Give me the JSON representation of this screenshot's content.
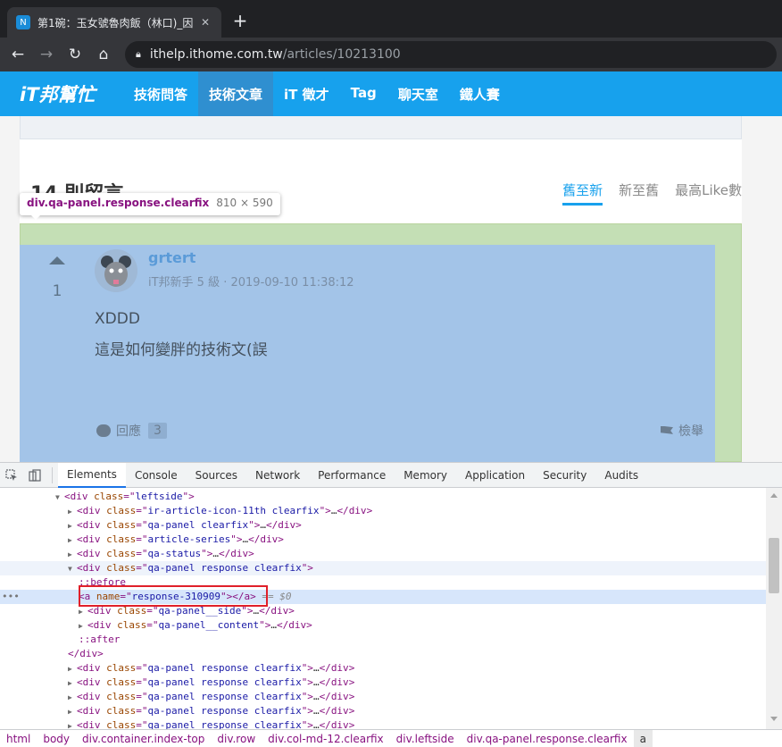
{
  "browser": {
    "tab_title": "第1碗：玉女號魯肉飯（林口)_因",
    "tab_favicon": "N",
    "url_host": "ithelp.ithome.com.tw",
    "url_path": "/articles/10213100"
  },
  "site": {
    "logo": "iT邦幫忙",
    "nav": [
      "技術問答",
      "技術文章",
      "iT 徵才",
      "Tag",
      "聊天室",
      "鐵人賽"
    ],
    "active_nav_index": 1,
    "accent_color": "#17a1ed"
  },
  "comments": {
    "heading": "14 則留言",
    "sort_options": [
      "舊至新",
      "新至舊",
      "最高Like數"
    ],
    "active_sort_index": 0
  },
  "inspector_tooltip": {
    "selector": "div.qa-panel.response.clearfix",
    "size": "810 × 590"
  },
  "comment": {
    "votes": "1",
    "author": "grtert",
    "meta": "iT邦新手 5 級 · 2019-09-10 11:38:12",
    "body_line1": "XDDD",
    "body_line2": "這是如何變胖的技術文(誤",
    "reply_label": "回應",
    "reply_count": "3",
    "report_label": "檢舉"
  },
  "devtools": {
    "tabs": [
      "Elements",
      "Console",
      "Sources",
      "Network",
      "Performance",
      "Memory",
      "Application",
      "Security",
      "Audits"
    ],
    "active_tab_index": 0,
    "breadcrumbs": [
      "html",
      "body",
      "div.container.index-top",
      "div.row",
      "div.col-md-12.clearfix",
      "div.leftside",
      "div.qa-panel.response.clearfix",
      "a"
    ]
  },
  "dom_tree": [
    {
      "indent": 62,
      "tri": "down",
      "type": "open",
      "tag": "div",
      "attr": "class",
      "val": "leftside",
      "tail": ""
    },
    {
      "indent": 76,
      "tri": "right",
      "type": "collapsed",
      "tag": "div",
      "attr": "class",
      "val": "ir-article-icon-11th clearfix",
      "tail": ""
    },
    {
      "indent": 76,
      "tri": "right",
      "type": "collapsed",
      "tag": "div",
      "attr": "class",
      "val": "qa-panel clearfix",
      "tail": ""
    },
    {
      "indent": 76,
      "tri": "right",
      "type": "collapsed",
      "tag": "div",
      "attr": "class",
      "val": "article-series",
      "tail": ""
    },
    {
      "indent": 76,
      "tri": "right",
      "type": "collapsed",
      "tag": "div",
      "attr": "class",
      "val": "qa-status",
      "tail": ""
    },
    {
      "indent": 76,
      "tri": "down",
      "type": "open",
      "tag": "div",
      "attr": "class",
      "val": "qa-panel response clearfix",
      "tail": "",
      "hl": "parent"
    },
    {
      "indent": 88,
      "tri": "",
      "type": "pseudo",
      "text": "::before"
    },
    {
      "indent": 88,
      "tri": "",
      "type": "anchor",
      "tag": "a",
      "attr": "name",
      "val": "response-310909",
      "tail": "== $0",
      "hl": "selected"
    },
    {
      "indent": 88,
      "tri": "right",
      "type": "collapsed",
      "tag": "div",
      "attr": "class",
      "val": "qa-panel__side",
      "tail": ""
    },
    {
      "indent": 88,
      "tri": "right",
      "type": "collapsed",
      "tag": "div",
      "attr": "class",
      "val": "qa-panel__content",
      "tail": ""
    },
    {
      "indent": 88,
      "tri": "",
      "type": "pseudo",
      "text": "::after"
    },
    {
      "indent": 76,
      "tri": "",
      "type": "close",
      "tag": "div"
    },
    {
      "indent": 76,
      "tri": "right",
      "type": "collapsed",
      "tag": "div",
      "attr": "class",
      "val": "qa-panel response clearfix",
      "tail": ""
    },
    {
      "indent": 76,
      "tri": "right",
      "type": "collapsed",
      "tag": "div",
      "attr": "class",
      "val": "qa-panel response clearfix",
      "tail": ""
    },
    {
      "indent": 76,
      "tri": "right",
      "type": "collapsed",
      "tag": "div",
      "attr": "class",
      "val": "qa-panel response clearfix",
      "tail": ""
    },
    {
      "indent": 76,
      "tri": "right",
      "type": "collapsed",
      "tag": "div",
      "attr": "class",
      "val": "qa-panel response clearfix",
      "tail": ""
    },
    {
      "indent": 76,
      "tri": "right",
      "type": "collapsed",
      "tag": "div",
      "attr": "class",
      "val": "qa-panel response clearfix",
      "tail": ""
    }
  ]
}
